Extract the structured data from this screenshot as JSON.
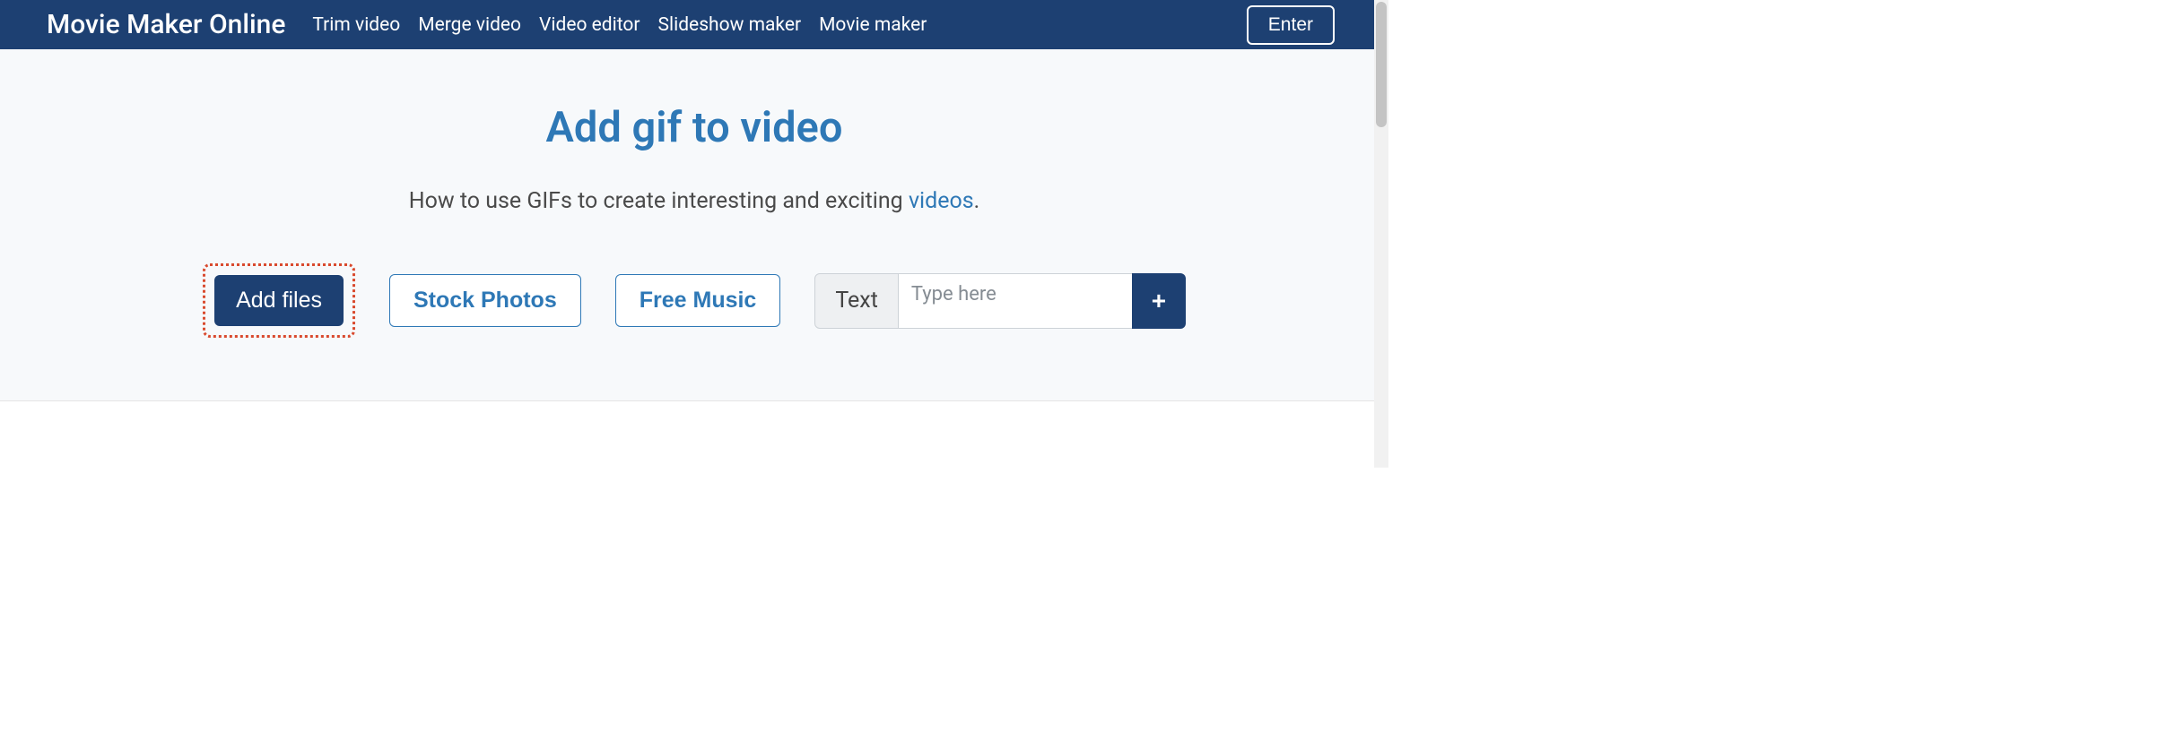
{
  "nav": {
    "brand": "Movie Maker Online",
    "links": [
      "Trim video",
      "Merge video",
      "Video editor",
      "Slideshow maker",
      "Movie maker"
    ],
    "enter": "Enter"
  },
  "hero": {
    "title": "Add gif to video",
    "subtitle_before": "How to use GIFs to create interesting and exciting ",
    "subtitle_link": "videos",
    "subtitle_after": "."
  },
  "actions": {
    "add_files": "Add files",
    "stock_photos": "Stock Photos",
    "free_music": "Free Music",
    "text_label": "Text",
    "text_placeholder": "Type here",
    "plus": "+"
  }
}
